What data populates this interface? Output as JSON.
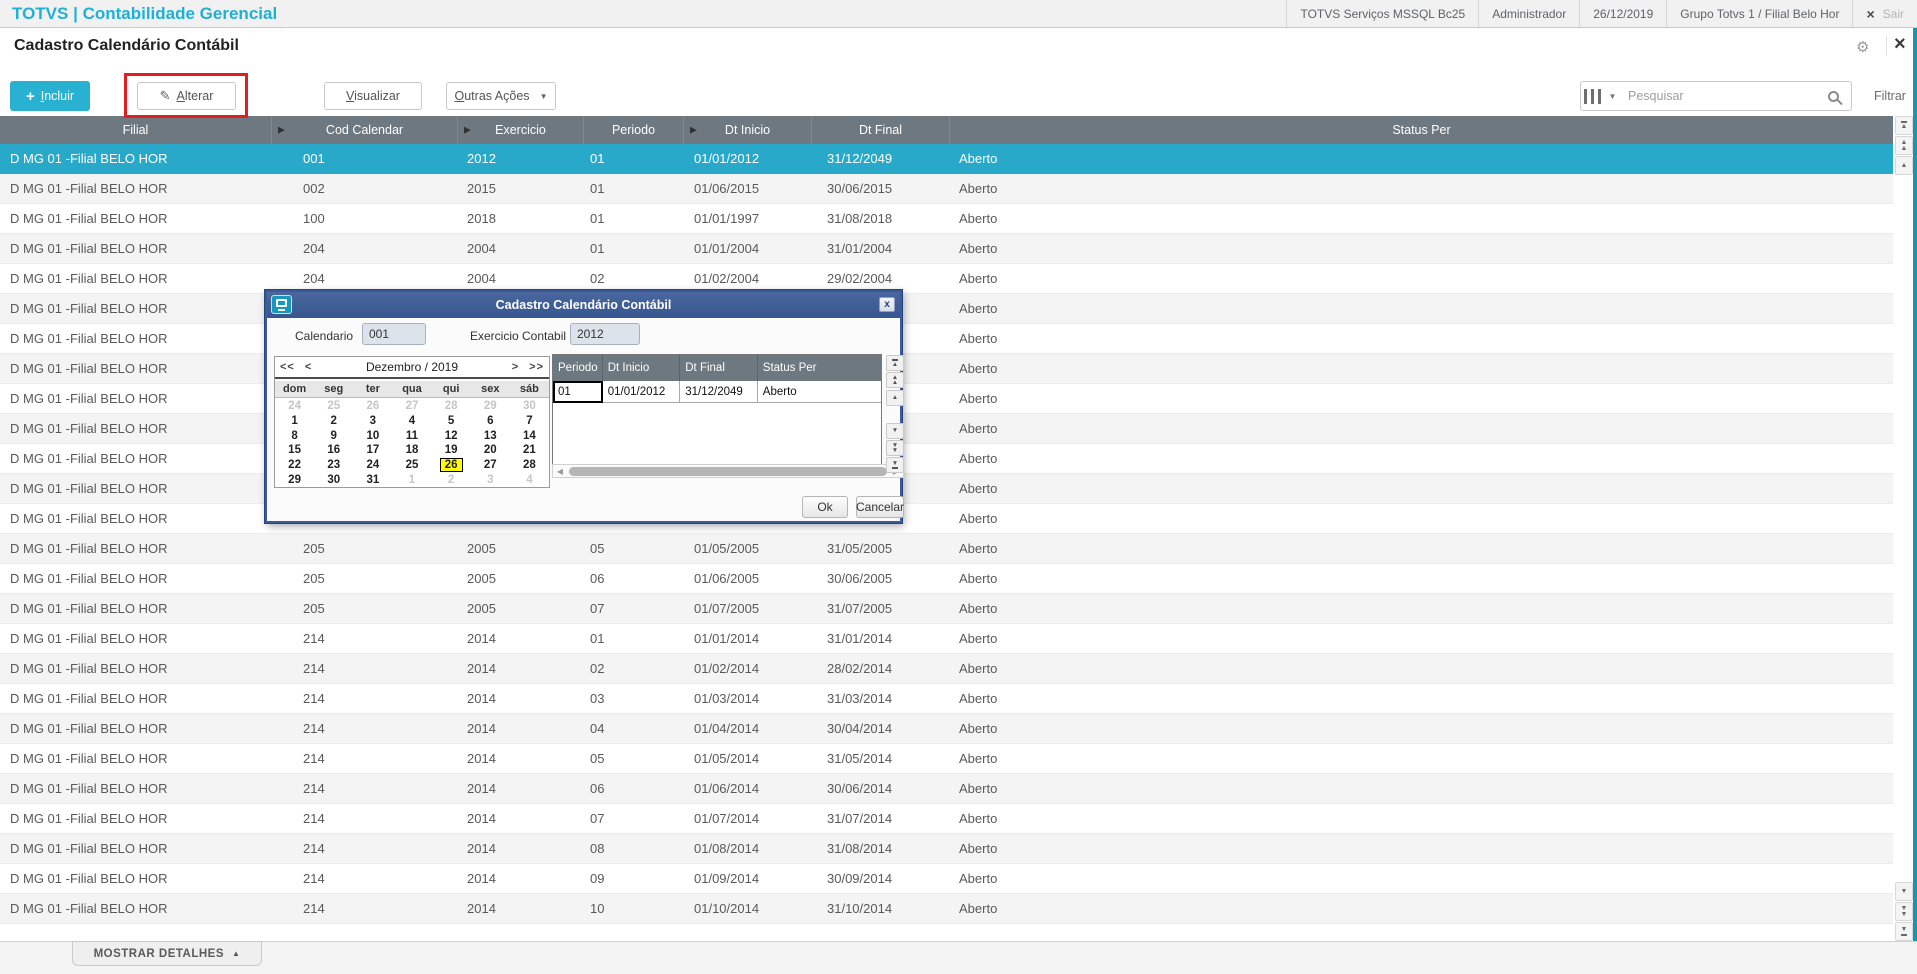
{
  "topbar": {
    "brand": "TOTVS | Contabilidade Gerencial",
    "items": [
      "TOTVS Serviços MSSQL Bc25",
      "Administrador",
      "26/12/2019",
      "Grupo Totvs 1 / Filial Belo Hor"
    ],
    "exit_x": "×",
    "exit_label": "Sair"
  },
  "page": {
    "title": "Cadastro Calendário Contábil",
    "close_x": "×",
    "gear": "⚙"
  },
  "toolbar": {
    "incluir": "Incluir",
    "alterar": "Alterar",
    "visualizar": "Visualizar",
    "outras_acoes": "Outras Ações",
    "search_placeholder": "Pesquisar",
    "filtrar": "Filtrar"
  },
  "table": {
    "columns": [
      "Filial",
      "Cod Calendar",
      "Exercicio",
      "Periodo",
      "Dt Inicio",
      "Dt Final",
      "Status Per"
    ],
    "sorted_arrow_columns": [
      1,
      2,
      4
    ],
    "selected_index": 0,
    "rows": [
      [
        "D MG 01 -Filial BELO HOR",
        "001",
        "2012",
        "01",
        "01/01/2012",
        "31/12/2049",
        "Aberto"
      ],
      [
        "D MG 01 -Filial BELO HOR",
        "002",
        "2015",
        "01",
        "01/06/2015",
        "30/06/2015",
        "Aberto"
      ],
      [
        "D MG 01 -Filial BELO HOR",
        "100",
        "2018",
        "01",
        "01/01/1997",
        "31/08/2018",
        "Aberto"
      ],
      [
        "D MG 01 -Filial BELO HOR",
        "204",
        "2004",
        "01",
        "01/01/2004",
        "31/01/2004",
        "Aberto"
      ],
      [
        "D MG 01 -Filial BELO HOR",
        "204",
        "2004",
        "02",
        "01/02/2004",
        "29/02/2004",
        "Aberto"
      ],
      [
        "D MG 01 -Filial BELO HOR",
        "",
        "",
        "",
        "",
        "",
        "Aberto"
      ],
      [
        "D MG 01 -Filial BELO HOR",
        "",
        "",
        "",
        "",
        "",
        "Aberto"
      ],
      [
        "D MG 01 -Filial BELO HOR",
        "",
        "",
        "",
        "",
        "",
        "Aberto"
      ],
      [
        "D MG 01 -Filial BELO HOR",
        "",
        "",
        "",
        "",
        "",
        "Aberto"
      ],
      [
        "D MG 01 -Filial BELO HOR",
        "",
        "",
        "",
        "",
        "",
        "Aberto"
      ],
      [
        "D MG 01 -Filial BELO HOR",
        "",
        "",
        "",
        "",
        "",
        "Aberto"
      ],
      [
        "D MG 01 -Filial BELO HOR",
        "",
        "",
        "",
        "",
        "",
        "Aberto"
      ],
      [
        "D MG 01 -Filial BELO HOR",
        "",
        "",
        "",
        "",
        "",
        "Aberto"
      ],
      [
        "D MG 01 -Filial BELO HOR",
        "205",
        "2005",
        "05",
        "01/05/2005",
        "31/05/2005",
        "Aberto"
      ],
      [
        "D MG 01 -Filial BELO HOR",
        "205",
        "2005",
        "06",
        "01/06/2005",
        "30/06/2005",
        "Aberto"
      ],
      [
        "D MG 01 -Filial BELO HOR",
        "205",
        "2005",
        "07",
        "01/07/2005",
        "31/07/2005",
        "Aberto"
      ],
      [
        "D MG 01 -Filial BELO HOR",
        "214",
        "2014",
        "01",
        "01/01/2014",
        "31/01/2014",
        "Aberto"
      ],
      [
        "D MG 01 -Filial BELO HOR",
        "214",
        "2014",
        "02",
        "01/02/2014",
        "28/02/2014",
        "Aberto"
      ],
      [
        "D MG 01 -Filial BELO HOR",
        "214",
        "2014",
        "03",
        "01/03/2014",
        "31/03/2014",
        "Aberto"
      ],
      [
        "D MG 01 -Filial BELO HOR",
        "214",
        "2014",
        "04",
        "01/04/2014",
        "30/04/2014",
        "Aberto"
      ],
      [
        "D MG 01 -Filial BELO HOR",
        "214",
        "2014",
        "05",
        "01/05/2014",
        "31/05/2014",
        "Aberto"
      ],
      [
        "D MG 01 -Filial BELO HOR",
        "214",
        "2014",
        "06",
        "01/06/2014",
        "30/06/2014",
        "Aberto"
      ],
      [
        "D MG 01 -Filial BELO HOR",
        "214",
        "2014",
        "07",
        "01/07/2014",
        "31/07/2014",
        "Aberto"
      ],
      [
        "D MG 01 -Filial BELO HOR",
        "214",
        "2014",
        "08",
        "01/08/2014",
        "31/08/2014",
        "Aberto"
      ],
      [
        "D MG 01 -Filial BELO HOR",
        "214",
        "2014",
        "09",
        "01/09/2014",
        "30/09/2014",
        "Aberto"
      ],
      [
        "D MG 01 -Filial BELO HOR",
        "214",
        "2014",
        "10",
        "01/10/2014",
        "31/10/2014",
        "Aberto"
      ]
    ]
  },
  "modal": {
    "title": "Cadastro Calendário Contábil",
    "close_x": "x",
    "calendario_label": "Calendario",
    "calendario_value": "001",
    "exercicio_label": "Exercicio Contabil",
    "exercicio_value": "2012",
    "calendar": {
      "month_label": "Dezembro / 2019",
      "nav_prev_year": "<<",
      "nav_prev_month": "<",
      "nav_next_month": ">",
      "nav_next_year": ">>",
      "day_names": [
        "dom",
        "seg",
        "ter",
        "qua",
        "qui",
        "sex",
        "sáb"
      ],
      "selected_day": "26",
      "weeks": [
        [
          {
            "d": "24",
            "out": true
          },
          {
            "d": "25",
            "out": true
          },
          {
            "d": "26",
            "out": true
          },
          {
            "d": "27",
            "out": true
          },
          {
            "d": "28",
            "out": true
          },
          {
            "d": "29",
            "out": true
          },
          {
            "d": "30",
            "out": true
          }
        ],
        [
          {
            "d": "1"
          },
          {
            "d": "2"
          },
          {
            "d": "3"
          },
          {
            "d": "4"
          },
          {
            "d": "5"
          },
          {
            "d": "6"
          },
          {
            "d": "7"
          }
        ],
        [
          {
            "d": "8"
          },
          {
            "d": "9"
          },
          {
            "d": "10"
          },
          {
            "d": "11"
          },
          {
            "d": "12"
          },
          {
            "d": "13"
          },
          {
            "d": "14"
          }
        ],
        [
          {
            "d": "15"
          },
          {
            "d": "16"
          },
          {
            "d": "17"
          },
          {
            "d": "18"
          },
          {
            "d": "19"
          },
          {
            "d": "20"
          },
          {
            "d": "21"
          }
        ],
        [
          {
            "d": "22"
          },
          {
            "d": "23"
          },
          {
            "d": "24"
          },
          {
            "d": "25"
          },
          {
            "d": "26",
            "sel": true
          },
          {
            "d": "27"
          },
          {
            "d": "28"
          }
        ],
        [
          {
            "d": "29"
          },
          {
            "d": "30"
          },
          {
            "d": "31"
          },
          {
            "d": "1",
            "out": true
          },
          {
            "d": "2",
            "out": true
          },
          {
            "d": "3",
            "out": true
          },
          {
            "d": "4",
            "out": true
          }
        ]
      ]
    },
    "grid": {
      "columns": [
        "Periodo",
        "Dt Inicio",
        "Dt Final",
        "Status Per"
      ],
      "rows": [
        [
          "01",
          "01/01/2012",
          "31/12/2049",
          "Aberto"
        ]
      ]
    },
    "ok": "Ok",
    "cancelar": "Cancelar"
  },
  "footer": {
    "mostrar_detalhes": "MOSTRAR DETALHES"
  }
}
